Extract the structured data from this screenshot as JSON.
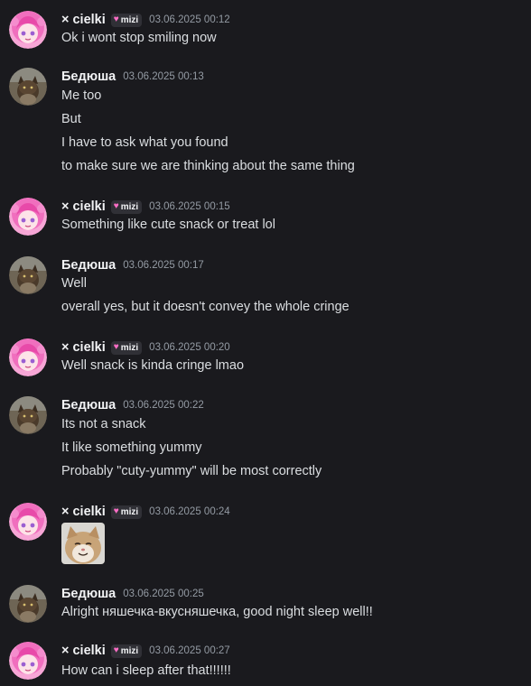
{
  "messages": [
    {
      "author": "× cielki",
      "tag": "mizi",
      "avatar": "pink-hair-anime-avatar",
      "timestamp": "03.06.2025 00:12",
      "lines": [
        "Ok i wont stop smiling now"
      ]
    },
    {
      "author": "Бедюша",
      "avatar": "cat-photo-avatar",
      "timestamp": "03.06.2025 00:13",
      "lines": [
        "Me too",
        "But",
        "I have to ask what you found",
        "to make sure we are thinking about the same thing"
      ]
    },
    {
      "author": "× cielki",
      "tag": "mizi",
      "avatar": "pink-hair-anime-avatar",
      "timestamp": "03.06.2025 00:15",
      "lines": [
        "Something like cute snack or treat lol"
      ]
    },
    {
      "author": "Бедюша",
      "avatar": "cat-photo-avatar",
      "timestamp": "03.06.2025 00:17",
      "lines": [
        "Well",
        "overall yes, but it doesn't convey the whole cringe"
      ]
    },
    {
      "author": "× cielki",
      "tag": "mizi",
      "avatar": "pink-hair-anime-avatar",
      "timestamp": "03.06.2025 00:20",
      "lines": [
        "Well snack is kinda cringe lmao"
      ]
    },
    {
      "author": "Бедюша",
      "avatar": "cat-photo-avatar",
      "timestamp": "03.06.2025 00:22",
      "lines": [
        "Its not a snack",
        "It like something yummy",
        "Probably \"cuty-yummy\" will be most correctly"
      ]
    },
    {
      "author": "× cielki",
      "tag": "mizi",
      "avatar": "pink-hair-anime-avatar",
      "timestamp": "03.06.2025 00:24",
      "attachment": "smiling-cat-image"
    },
    {
      "author": "Бедюша",
      "avatar": "cat-photo-avatar",
      "timestamp": "03.06.2025 00:25",
      "lines": [
        "Alright няшечка-вкусняшечка, good night sleep well!!"
      ]
    },
    {
      "author": "× cielki",
      "tag": "mizi",
      "avatar": "pink-hair-anime-avatar",
      "timestamp": "03.06.2025 00:27",
      "lines": [
        "How can i sleep after that!!!!!!"
      ]
    }
  ],
  "colors": {
    "background": "#1a1a1e",
    "username": "#f2f3f5",
    "text": "#dbdee1",
    "timestamp": "#949ba4",
    "tag_background": "#303036",
    "tag_heart": "#ff6ec7"
  }
}
